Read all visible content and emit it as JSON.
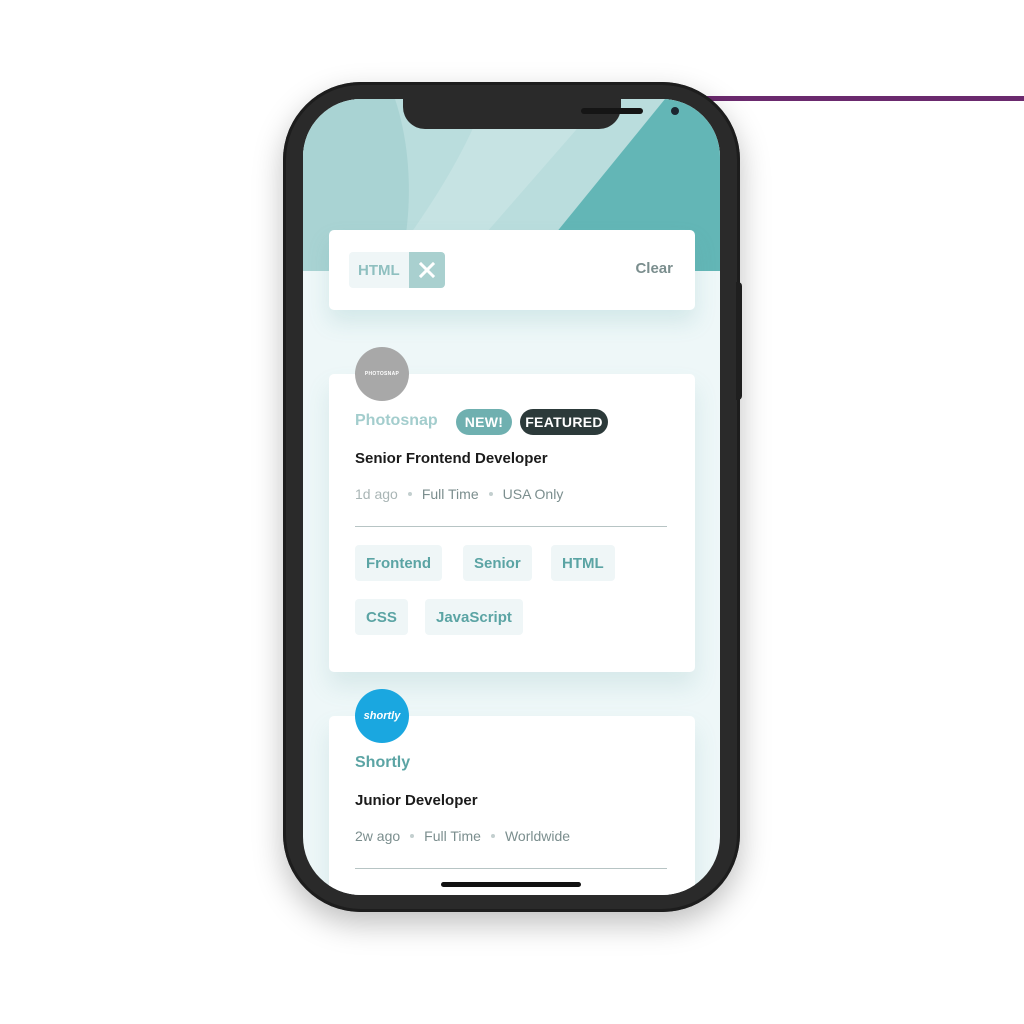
{
  "filter_bar": {
    "filters": [
      "HTML"
    ],
    "clear_label": "Clear"
  },
  "jobs": [
    {
      "company": "Photosnap",
      "logo_text": "PHOTOSNAP",
      "logo_color": "#a8a8a8",
      "new_label": "NEW!",
      "featured_label": "FEATURED",
      "position": "Senior Frontend Developer",
      "posted": "1d ago",
      "contract": "Full Time",
      "location": "USA Only",
      "tags": [
        "Frontend",
        "Senior",
        "HTML",
        "CSS",
        "JavaScript"
      ]
    },
    {
      "company": "Shortly",
      "logo_text": "shortly",
      "logo_color": "#1aa7e0",
      "position": "Junior Developer",
      "posted": "2w ago",
      "contract": "Full Time",
      "location": "Worldwide"
    }
  ],
  "colors": {
    "primary": "#5ba4a4",
    "dark": "#2c3a3a",
    "light_bg": "#eff6f7",
    "header": "#badddd"
  }
}
